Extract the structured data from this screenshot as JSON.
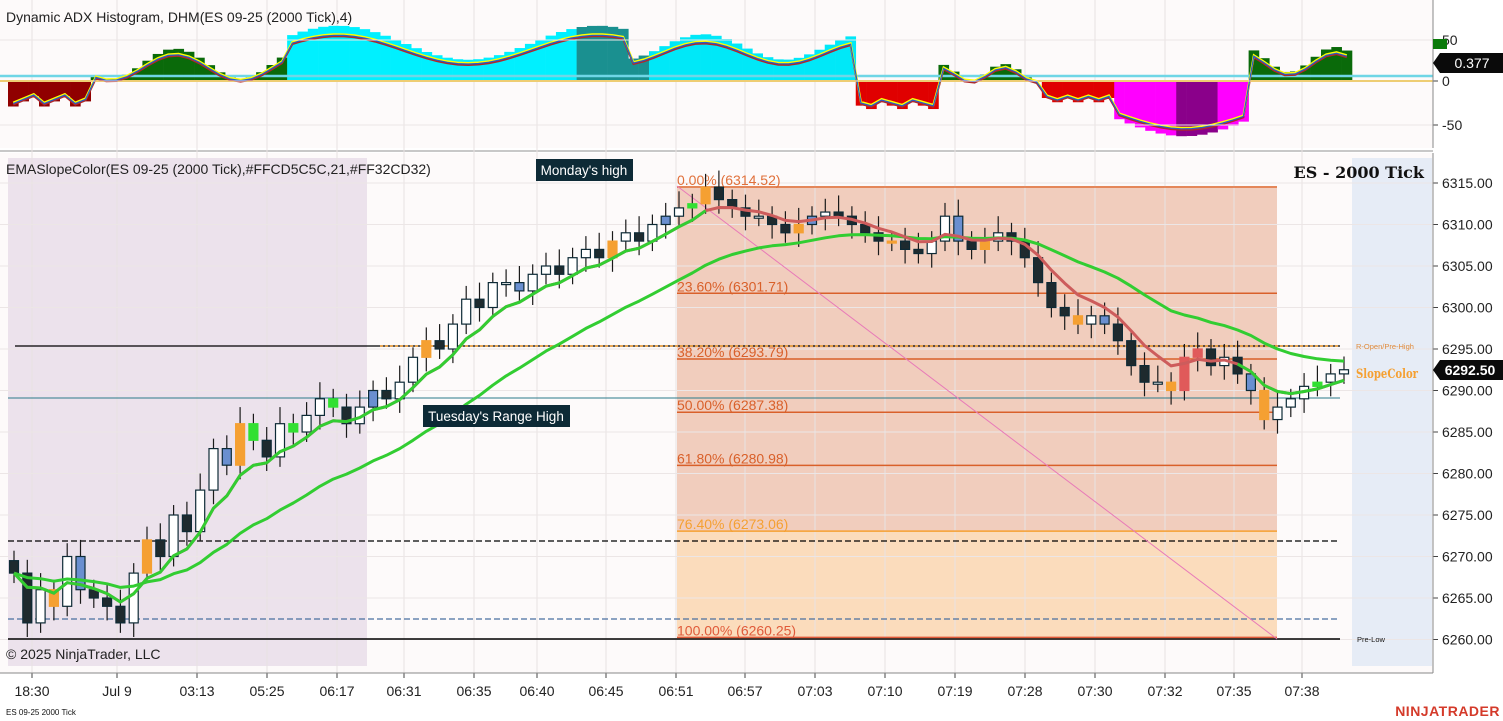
{
  "adx_panel": {
    "title": "Dynamic ADX Histogram, DHM(ES 09-25 (2000 Tick),4)",
    "y_ticks": [
      "50",
      "0",
      "-50"
    ],
    "current_value": "0.377",
    "value_color": "#0a0a0a"
  },
  "price_panel": {
    "title": "EMASlopeColor(ES 09-25 (2000 Tick),#FFCD5C5C,21,#FF32CD32)",
    "instrument_label": "ES - 2000 Tick",
    "copyright": "© 2025 NinjaTrader, LLC",
    "current_price": "6292.50",
    "y_ticks": [
      "6315.00",
      "6310.00",
      "6305.00",
      "6300.00",
      "6295.00",
      "6290.00",
      "6285.00",
      "6280.00",
      "6275.00",
      "6270.00",
      "6265.00",
      "6260.00"
    ],
    "annotations": {
      "mondays_high": "Monday's high",
      "tuesdays_range_high": "Tuesday's Range High",
      "r_open_pre_high": "R-Open/Pre-High",
      "pre_low": "Pre-Low",
      "slope_color": "SlopeColor"
    },
    "fib_levels": [
      {
        "label": "0.00% (6314.52)",
        "price": 6314.52,
        "color": "#e0703a"
      },
      {
        "label": "23.60% (6301.71)",
        "price": 6301.71,
        "color": "#d9602a"
      },
      {
        "label": "38.20% (6293.79)",
        "price": 6293.79,
        "color": "#d9602a"
      },
      {
        "label": "50.00% (6287.38)",
        "price": 6287.38,
        "color": "#d9602a"
      },
      {
        "label": "61.80% (6280.98)",
        "price": 6280.98,
        "color": "#d9602a"
      },
      {
        "label": "76.40% (6273.06)",
        "price": 6273.06,
        "color": "#f5a032"
      },
      {
        "label": "100.00% (6260.25)",
        "price": 6260.25,
        "color": "#e05a3a"
      }
    ]
  },
  "x_ticks": [
    "18:30",
    "Jul 9",
    "03:13",
    "05:25",
    "06:17",
    "06:31",
    "06:35",
    "06:40",
    "06:45",
    "06:51",
    "06:57",
    "07:03",
    "07:10",
    "07:19",
    "07:28",
    "07:30",
    "07:32",
    "07:35",
    "07:38"
  ],
  "footer": {
    "instrument": "ES 09-25 2000 Tick",
    "brand": "NINJATRADER"
  },
  "colors": {
    "ema_up": "#32CD32",
    "ema_down": "#CD5C5C",
    "brand": "#d43a2a"
  },
  "chart_data": {
    "type": "candlestick",
    "ylim": [
      6258,
      6316.5
    ],
    "closes": [
      6268,
      6262,
      6266,
      6264,
      6270,
      6266,
      6265,
      6264,
      6262,
      6268,
      6272,
      6270,
      6275,
      6273,
      6278,
      6283,
      6281,
      6286,
      6284,
      6282,
      6286,
      6285,
      6287,
      6289,
      6288,
      6286,
      6288,
      6290,
      6289,
      6291,
      6294,
      6296,
      6295,
      6298,
      6301,
      6300,
      6303,
      6303,
      6302,
      6304,
      6305,
      6304,
      6306,
      6307,
      6306,
      6308,
      6309,
      6308,
      6310,
      6311,
      6312,
      6312.5,
      6314.5,
      6313,
      6312,
      6311,
      6311,
      6310,
      6309,
      6310,
      6311,
      6311.5,
      6311,
      6310,
      6309,
      6308,
      6308,
      6307,
      6306.5,
      6308,
      6311,
      6308,
      6307,
      6308,
      6309,
      6308,
      6306,
      6303,
      6300,
      6299,
      6298,
      6299,
      6298,
      6296,
      6293,
      6291,
      6291,
      6290,
      6294,
      6295,
      6293,
      6294,
      6292,
      6290,
      6286.5,
      6288,
      6289,
      6290.5,
      6291,
      6292,
      6292.5
    ],
    "ema_lengths": {
      "period": 21
    }
  }
}
